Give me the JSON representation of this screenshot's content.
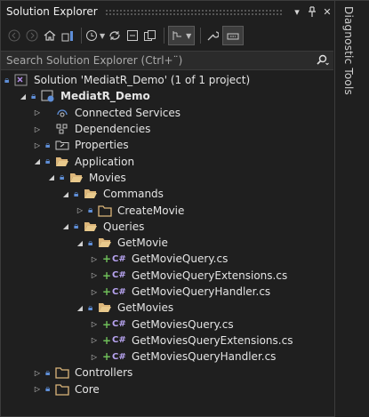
{
  "panel": {
    "title": "Solution Explorer",
    "side_tab": "Diagnostic Tools",
    "buttons": {
      "dropdown": "▾",
      "pin": "⊣",
      "close": "✕"
    }
  },
  "toolbar": {
    "icons": [
      "back-icon",
      "forward-icon",
      "home-icon",
      "switch-views-icon",
      "history-icon",
      "sync-icon",
      "collapse-all-icon",
      "show-all-files-icon",
      "filter-icon",
      "properties-icon",
      "preview-icon"
    ]
  },
  "search": {
    "placeholder": "Search Solution Explorer (Ctrl+¨)"
  },
  "tree": {
    "solution": "Solution 'MediatR_Demo' (1 of 1 project)",
    "project": "MediatR_Demo",
    "connected_services": "Connected Services",
    "dependencies": "Dependencies",
    "properties": "Properties",
    "application": "Application",
    "movies": "Movies",
    "commands": "Commands",
    "create_movie": "CreateMovie",
    "queries": "Queries",
    "get_movie": "GetMovie",
    "get_movie_files": [
      "GetMovieQuery.cs",
      "GetMovieQueryExtensions.cs",
      "GetMovieQueryHandler.cs"
    ],
    "get_movies": "GetMovies",
    "get_movies_files": [
      "GetMoviesQuery.cs",
      "GetMoviesQueryExtensions.cs",
      "GetMoviesQueryHandler.cs"
    ],
    "controllers": "Controllers",
    "core": "Core",
    "cs_badge": "C#"
  },
  "colors": {
    "background": "#1f1f1f",
    "folder": "#dcb67a",
    "lock": "#5f8fd8",
    "added": "#6fbf5a",
    "csharp": "#b7a3f0"
  }
}
